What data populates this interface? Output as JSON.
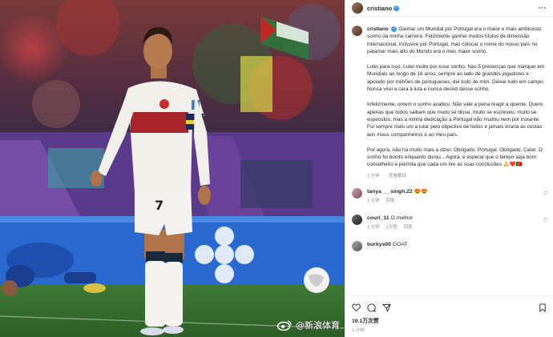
{
  "post": {
    "username": "cristiano",
    "verified_icon": "verified-badge-icon",
    "more_icon": "more-options-icon"
  },
  "caption": {
    "username": "cristiano",
    "paragraphs": [
      "Ganhar um Mundial por Portugal era o maior e mais ambicioso sonho da minha carreira. Felizmente ganhei muitos títulos de dimensão internacional, inclusive por Portugal, mas colocar o nome do nosso país no patamar mais alto do Mundo era o meu maior sonho.",
      "Lutei para isso. Lutei muito por esse sonho. Nas 5 presenças que marquei em Mundiais ao longo de 16 anos, sempre ao lado de grandes jogadores e apoiado por milhões de portugueses, dei tudo de mim. Deixei tudo em campo. Nunca virei a cara à luta e nunca desisti desse sonho.",
      "Infelizmente, ontem o sonho acabou. Não vale a pena reagir a quente. Quero apenas que todos saibam que muito se disse, muito se escreveu, muito se especulou, mas a minha dedicação a Portugal não mudou nem por instante. Fui sempre mais um a lutar pelo objectivo de todos e jamais viraria as costas aos meus companheiros e ao meu país.",
      "Por agora, não há muito mais a dizer. Obrigado, Portugal. Obrigado, Catar. O sonho foi bonito enquanto durou... Agora, é esperar que o tempo seja bom conselheiro e permita que cada um tire as suas conclusões 🙏❤️🇵🇹"
    ],
    "time": "1 分钟",
    "translate": "查看翻译"
  },
  "comments": [
    {
      "user": "tanya___singh.22",
      "text": "😍😍",
      "time": "1 分钟",
      "reply": "回复"
    },
    {
      "user": "couri_11",
      "text": "O melhor",
      "time": "1 分钟",
      "likes": "1次赞",
      "reply": "回复"
    },
    {
      "user": "burkys00",
      "text": "GOAT",
      "time": "",
      "reply": ""
    }
  ],
  "actions": {
    "likes": "19.1万次赞",
    "time": "1 分钟"
  },
  "watermark": {
    "text": "@新浪体育",
    "icon": "weibo-logo-icon"
  },
  "photo": {
    "jersey_number": "7"
  }
}
